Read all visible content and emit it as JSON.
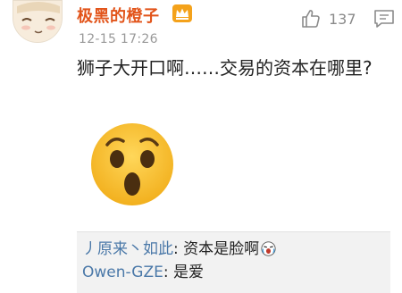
{
  "comment": {
    "username": "极黑的橙子",
    "badge_icon": "crown-icon",
    "timestamp": "12-15 17:26",
    "like_count": "137",
    "text": "狮子大开口啊……交易的资本在哪里?",
    "emoji_icon": "astonished-face-emoji",
    "accent_color": "#e2541a"
  },
  "replies": [
    {
      "user": "丿原来丶如此",
      "separator": ": ",
      "text": "资本是脸啊",
      "emoji": "laughing-crying-face-emoji"
    },
    {
      "user": "Owen-GZE",
      "separator": ": ",
      "text": "是爱"
    }
  ],
  "colors": {
    "reply_user": "#4a78a8",
    "reply_background": "#f2f2f2"
  }
}
